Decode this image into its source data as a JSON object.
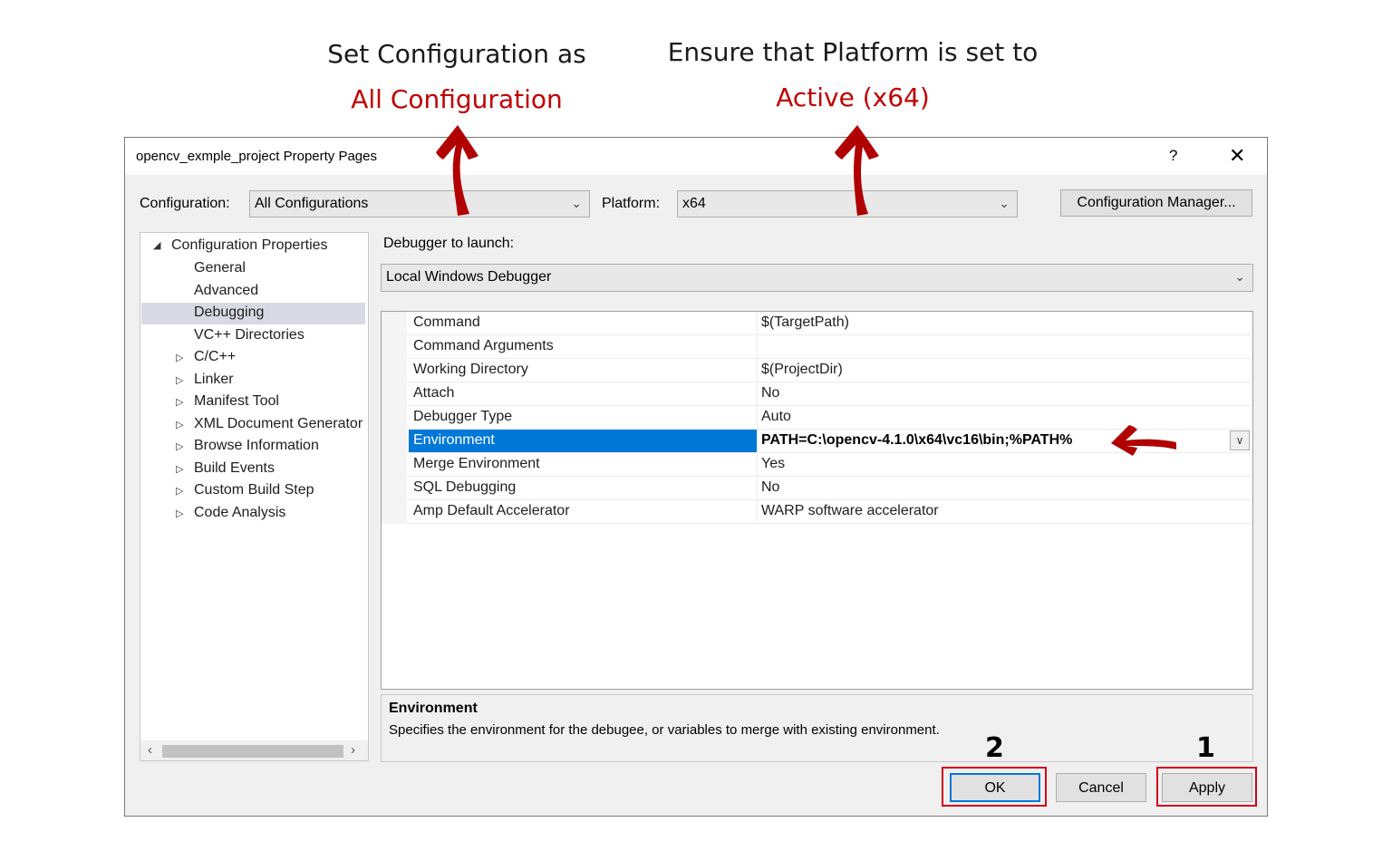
{
  "annotations": {
    "left_line1": "Set Configuration as",
    "left_line2": "All Configuration",
    "right_line1": "Ensure that Platform is set to",
    "right_line2": "Active (x64)",
    "step_ok": "2",
    "step_apply": "1"
  },
  "window": {
    "title": "opencv_exmple_project Property Pages",
    "help_glyph": "?",
    "close_glyph": "✕"
  },
  "toolbar": {
    "configuration_label": "Configuration:",
    "configuration_value": "All Configurations",
    "platform_label": "Platform:",
    "platform_value": "x64",
    "config_manager_label": "Configuration Manager..."
  },
  "tree": {
    "root": "Configuration Properties",
    "items": [
      {
        "label": "General",
        "expandable": false
      },
      {
        "label": "Advanced",
        "expandable": false
      },
      {
        "label": "Debugging",
        "expandable": false,
        "selected": true
      },
      {
        "label": "VC++ Directories",
        "expandable": false
      },
      {
        "label": "C/C++",
        "expandable": true
      },
      {
        "label": "Linker",
        "expandable": true
      },
      {
        "label": "Manifest Tool",
        "expandable": true
      },
      {
        "label": "XML Document Generator",
        "expandable": true
      },
      {
        "label": "Browse Information",
        "expandable": true
      },
      {
        "label": "Build Events",
        "expandable": true
      },
      {
        "label": "Custom Build Step",
        "expandable": true
      },
      {
        "label": "Code Analysis",
        "expandable": true
      }
    ]
  },
  "debugger": {
    "label": "Debugger to launch:",
    "value": "Local Windows Debugger"
  },
  "properties": [
    {
      "name": "Command",
      "value": "$(TargetPath)"
    },
    {
      "name": "Command Arguments",
      "value": ""
    },
    {
      "name": "Working Directory",
      "value": "$(ProjectDir)"
    },
    {
      "name": "Attach",
      "value": "No"
    },
    {
      "name": "Debugger Type",
      "value": "Auto"
    },
    {
      "name": "Environment",
      "value": "PATH=C:\\opencv-4.1.0\\x64\\vc16\\bin;%PATH%",
      "selected": true
    },
    {
      "name": "Merge Environment",
      "value": "Yes"
    },
    {
      "name": "SQL Debugging",
      "value": "No"
    },
    {
      "name": "Amp Default Accelerator",
      "value": "WARP software accelerator"
    }
  ],
  "description": {
    "heading": "Environment",
    "text": "Specifies the environment for the debugee, or variables to merge with existing environment."
  },
  "buttons": {
    "ok": "OK",
    "cancel": "Cancel",
    "apply": "Apply"
  },
  "colors": {
    "annotation_red": "#c00000",
    "highlight_box": "#d0021b",
    "selection_blue": "#0078d7"
  }
}
